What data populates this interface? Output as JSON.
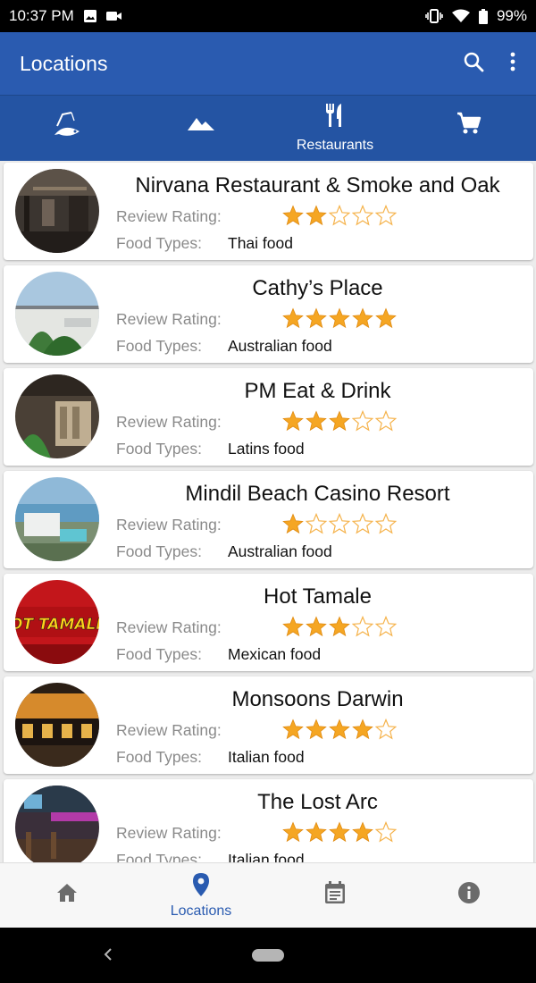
{
  "status_bar": {
    "time": "10:37 PM",
    "battery": "99%",
    "left_icons": [
      "image-icon",
      "video-camera-icon"
    ],
    "right_icons": [
      "vibrate-icon",
      "wifi-icon",
      "battery-icon"
    ]
  },
  "app_bar": {
    "title": "Locations",
    "actions": [
      "search-icon",
      "more-vert-icon"
    ]
  },
  "category_tabs": [
    {
      "icon": "fishing-icon",
      "label": ""
    },
    {
      "icon": "mountain-icon",
      "label": ""
    },
    {
      "icon": "restaurant-icon",
      "label": "Restaurants",
      "selected": true
    },
    {
      "icon": "shopping-cart-icon",
      "label": ""
    }
  ],
  "list_labels": {
    "rating": "Review Rating:",
    "food": "Food Types:"
  },
  "restaurants": [
    {
      "name": "Nirvana Restaurant & Smoke and Oak",
      "rating": 2,
      "food": "Thai food"
    },
    {
      "name": "Cathy’s Place",
      "rating": 5,
      "food": "Australian food"
    },
    {
      "name": "PM Eat & Drink",
      "rating": 3,
      "food": "Latins food"
    },
    {
      "name": "Mindil Beach Casino Resort",
      "rating": 1,
      "food": "Australian food"
    },
    {
      "name": "Hot Tamale",
      "rating": 3,
      "food": "Mexican food"
    },
    {
      "name": "Monsoons Darwin",
      "rating": 4,
      "food": "Italian food"
    },
    {
      "name": "The Lost Arc",
      "rating": 4,
      "food": "Italian food"
    }
  ],
  "bottom_nav": [
    {
      "icon": "home-icon",
      "label": ""
    },
    {
      "icon": "location-pin-icon",
      "label": "Locations",
      "active": true
    },
    {
      "icon": "calendar-icon",
      "label": ""
    },
    {
      "icon": "info-icon",
      "label": ""
    }
  ],
  "colors": {
    "app_bar": "#2a5bb0",
    "tab_bar": "#2454a3",
    "star": "#f5a623",
    "active_nav": "#2a5bb0"
  }
}
